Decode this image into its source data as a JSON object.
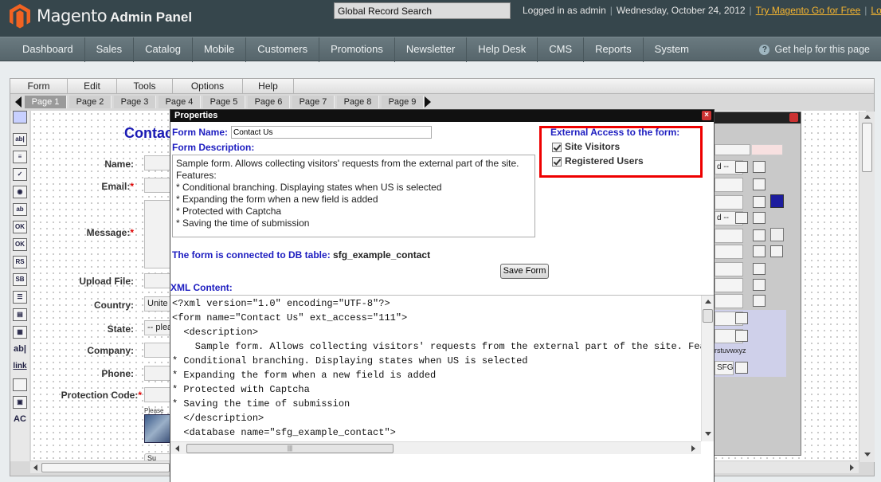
{
  "header": {
    "brand_name": "Magento",
    "brand_suffix": "Admin Panel",
    "search_value": "Global Record Search",
    "logged_in": "Logged in as admin",
    "date": "Wednesday, October 24, 2012",
    "try_link": "Try Magento Go for Free",
    "logout": "Log Out"
  },
  "nav": {
    "items": [
      "Dashboard",
      "Sales",
      "Catalog",
      "Mobile",
      "Customers",
      "Promotions",
      "Newsletter",
      "Help Desk",
      "CMS",
      "Reports",
      "System"
    ],
    "help": "Get help for this page"
  },
  "designer": {
    "menu": [
      "Form",
      "Edit",
      "Tools",
      "Options",
      "Help"
    ],
    "pages": [
      "Page 1",
      "Page 2",
      "Page 3",
      "Page 4",
      "Page 5",
      "Page 6",
      "Page 7",
      "Page 8",
      "Page 9"
    ],
    "active_page": "Page 1",
    "form_title": "Contac",
    "fields": {
      "name": "Name:",
      "email": "Email:",
      "message": "Message:",
      "upload": "Upload File:",
      "country": "Country:",
      "country_value": "Unite",
      "state": "State:",
      "state_value": "-- plea",
      "company": "Company:",
      "phone": "Phone:",
      "protection": "Protection Code:",
      "captcha_hint": "Please",
      "submit_partial": "Su"
    },
    "back_panel": {
      "row1": "d --",
      "row2": "d --",
      "alphabet": "rstuvwxyz",
      "sfg": "SFG"
    }
  },
  "properties": {
    "title": "Properties",
    "form_name_label": "Form Name:",
    "form_name_value": "Contact Us",
    "form_description_label": "Form Description:",
    "form_description": "Sample form. Allows collecting visitors' requests from the external part of the site.\nFeatures:\n* Conditional branching. Displaying states when US is selected\n* Expanding the form when a new field is added\n* Protected with Captcha\n* Saving the time of submission",
    "external_access_label": "External Access to the form:",
    "site_visitors": "Site Visitors",
    "registered_users": "Registered Users",
    "db_label": "The form is connected to DB table:",
    "db_table": "sfg_example_contact",
    "save_button": "Save Form",
    "xml_label": "XML Content:",
    "xml_content": "<?xml version=\"1.0\" encoding=\"UTF-8\"?>\n<form name=\"Contact Us\" ext_access=\"111\">\n  <description>\n    Sample form. Allows collecting visitors' requests from the external part of the site. Featu\n* Conditional branching. Displaying states when US is selected\n* Expanding the form when a new field is added\n* Protected with Captcha\n* Saving the time of submission\n  </description>\n  <database name=\"sfg_example_contact\">"
  }
}
